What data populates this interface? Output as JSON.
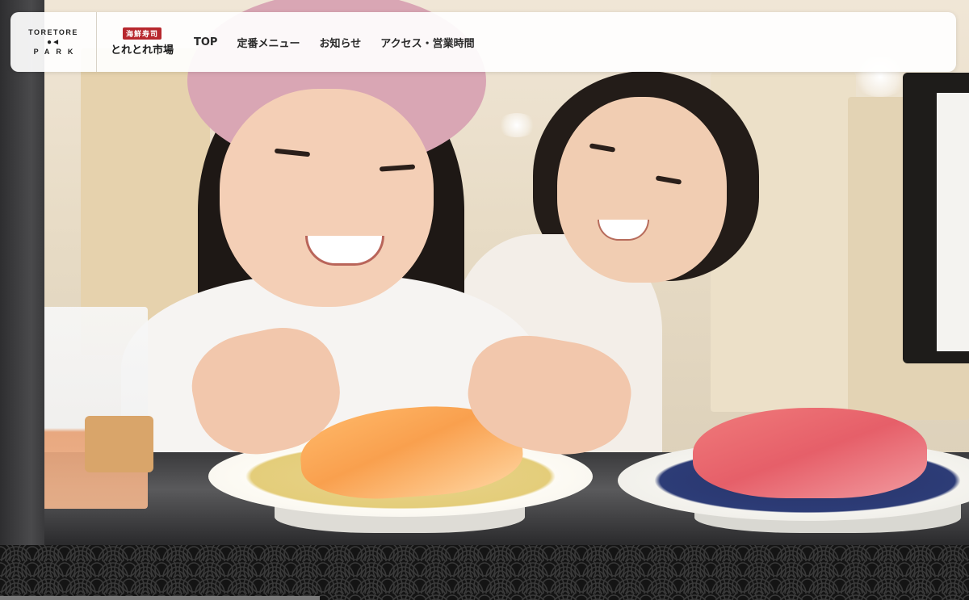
{
  "header": {
    "logo_park": {
      "line1": "TORETORE",
      "line2": "PARK"
    },
    "logo_sushi": {
      "badge": "海鮮寿司",
      "name": "とれとれ市場"
    },
    "nav": [
      {
        "label": "TOP"
      },
      {
        "label": "定番メニュー"
      },
      {
        "label": "お知らせ"
      },
      {
        "label": "アクセス・営業時間"
      }
    ]
  },
  "colors": {
    "brand_red": "#b7282e",
    "nav_bg": "#ffffff",
    "footer_pattern_bg": "#141414"
  },
  "hero": {
    "video_progress": 0.33
  }
}
